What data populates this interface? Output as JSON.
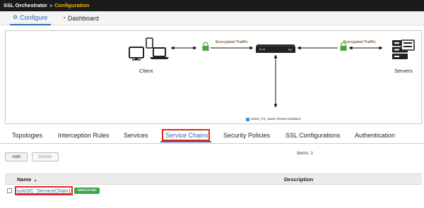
{
  "header": {
    "app_title": "SSL Orchestrator",
    "separator": "»",
    "breadcrumb": "Configuration"
  },
  "nav_tabs": [
    {
      "label": "Configure",
      "icon": "gears-icon",
      "active": true
    },
    {
      "label": "Dashboard",
      "icon": "dashboard-gauge-icon",
      "active": false
    }
  ],
  "diagram": {
    "client_label": "Client",
    "servers_label": "Servers",
    "traffic_left": "Encrypted Traffic",
    "traffic_right": "Encrypted Traffic",
    "legend_label": "ssloS_FS_SaaS-Tenant-Isolation",
    "legend_color": "#3b8fe0",
    "lock_color": "#4aa53a"
  },
  "sub_tabs": [
    {
      "label": "Topologies",
      "active": false
    },
    {
      "label": "Interception Rules",
      "active": false
    },
    {
      "label": "Services",
      "active": false
    },
    {
      "label": "Service Chains",
      "active": true
    },
    {
      "label": "Security Policies",
      "active": false
    },
    {
      "label": "SSL Configurations",
      "active": false
    },
    {
      "label": "Authentication",
      "active": false
    }
  ],
  "actions": {
    "add_label": "Add",
    "delete_label": "Delete",
    "items_count": "Items: 1"
  },
  "table": {
    "columns": [
      "Name",
      "Description"
    ],
    "rows": [
      {
        "name": "ssloSC_ServiceChain1",
        "status": "DEPLOYED",
        "description": ""
      }
    ]
  },
  "colors": {
    "accent": "#2a6db5",
    "highlight": "#e5281c",
    "deployed": "#3aa64b",
    "breadcrumb": "#f5b800"
  }
}
